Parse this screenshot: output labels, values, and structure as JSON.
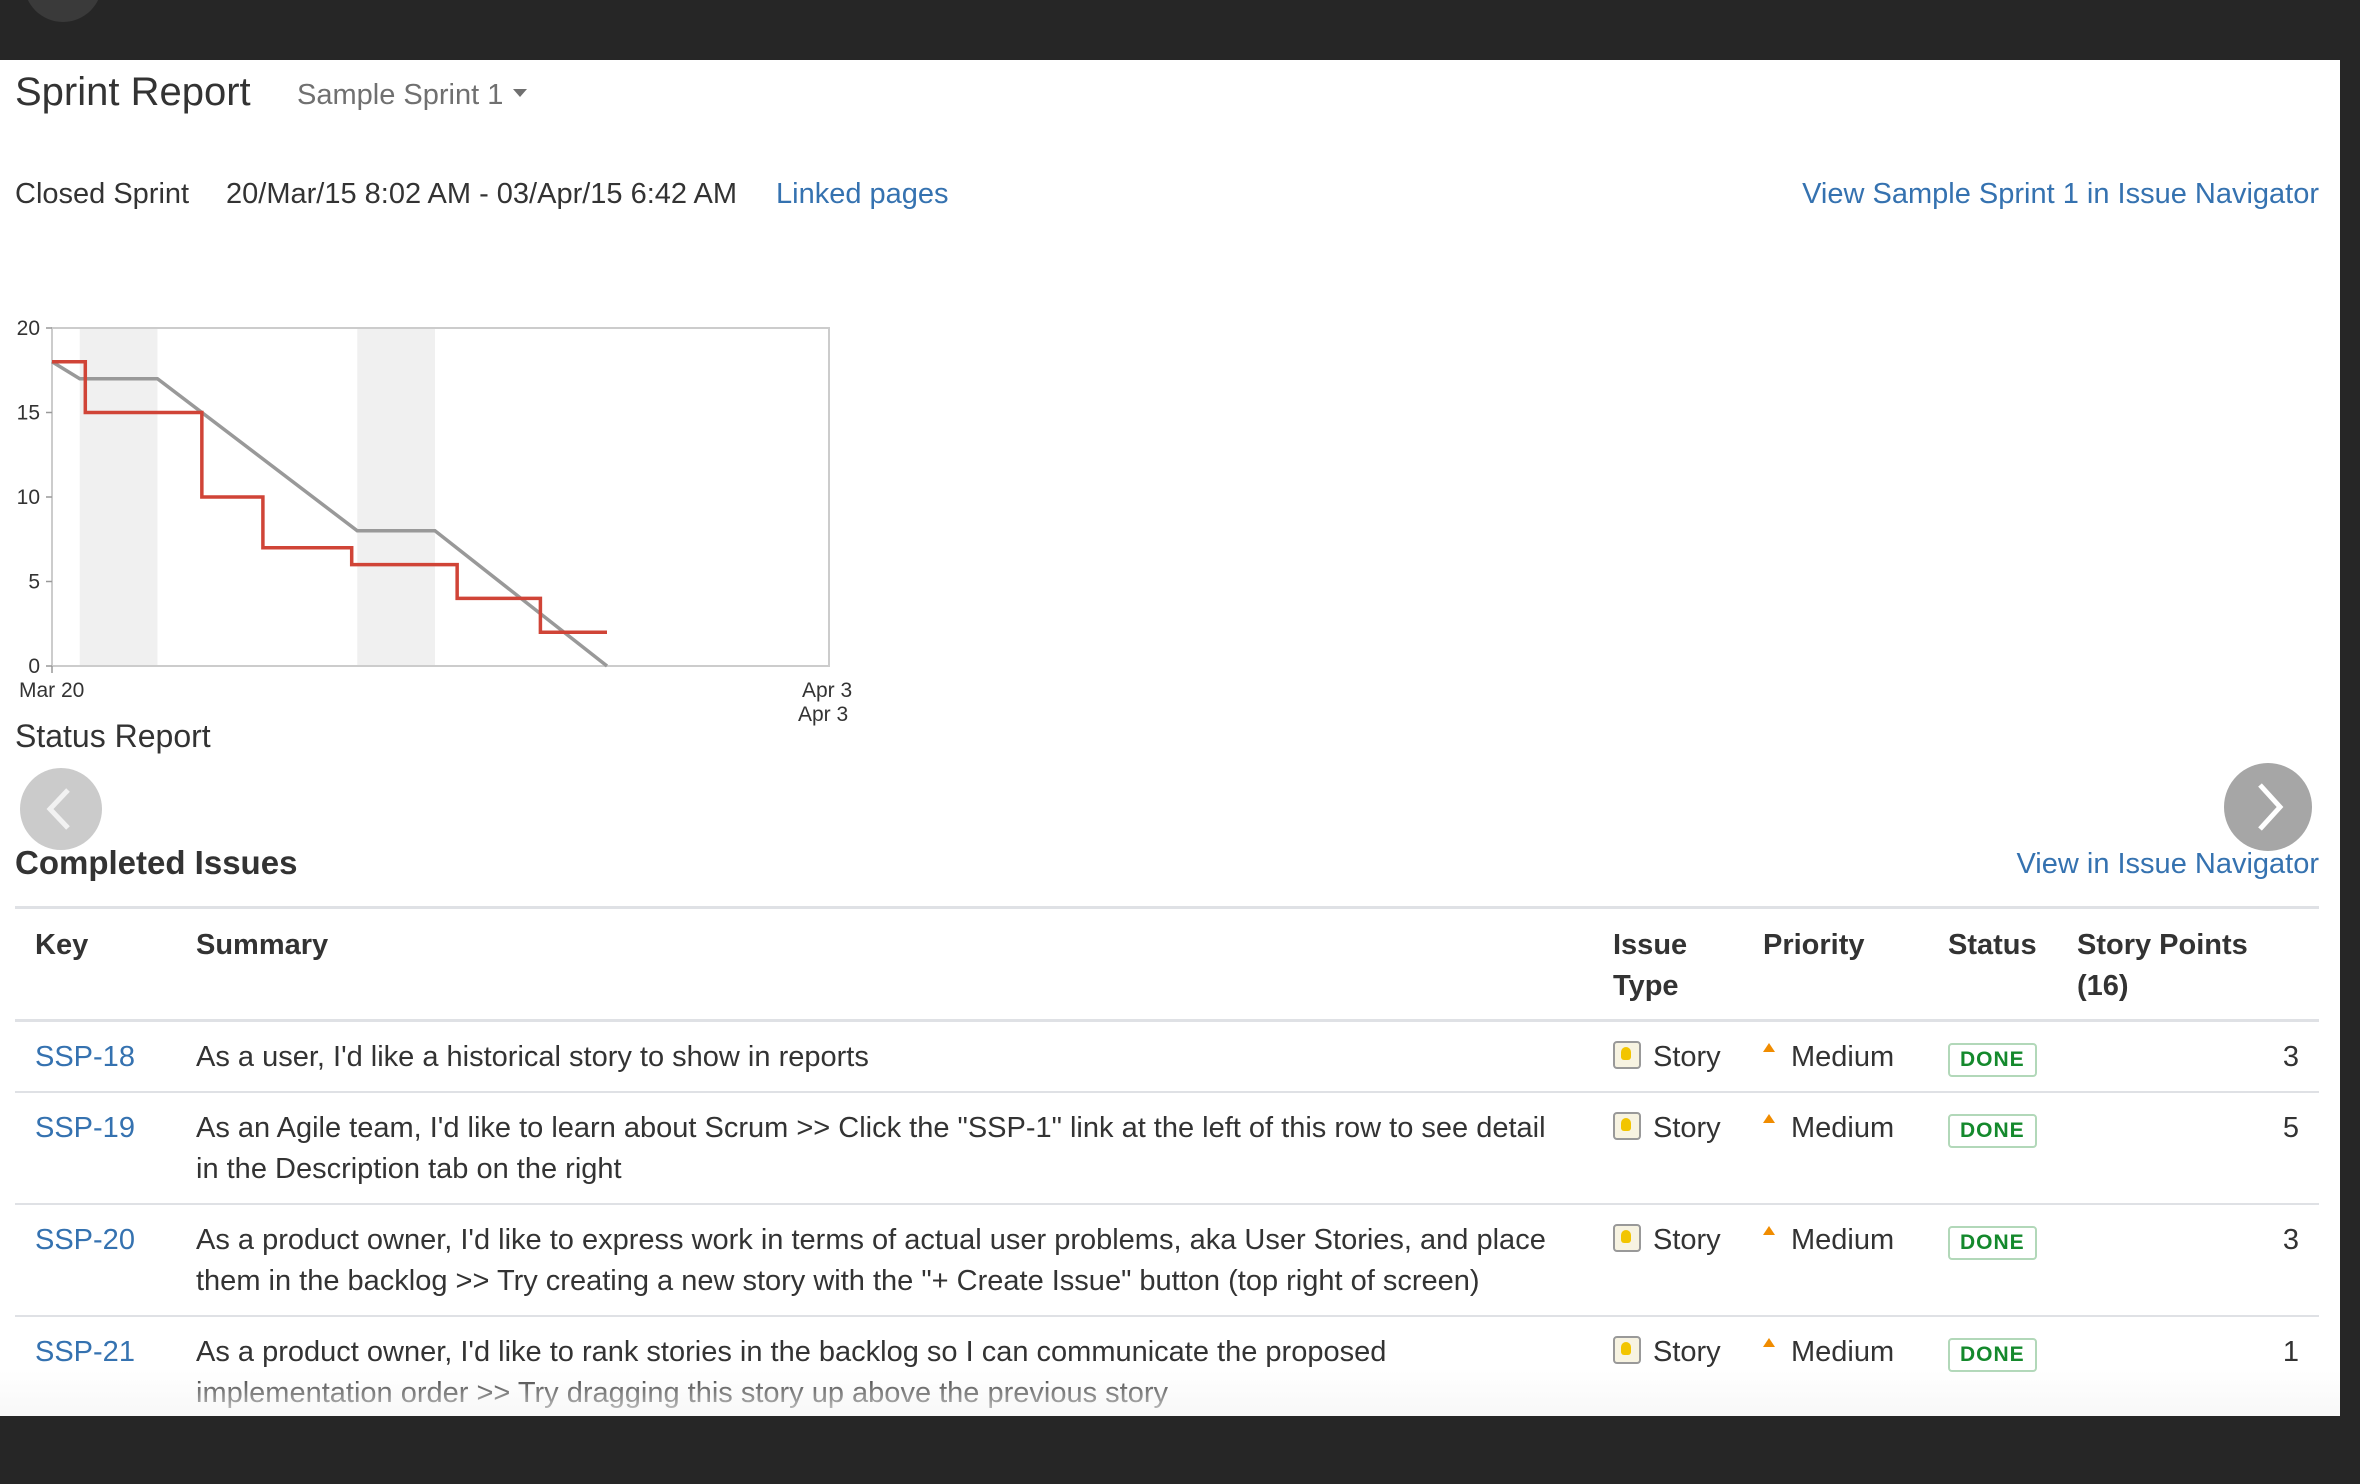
{
  "header": {
    "title": "Sprint Report",
    "sprint_selector": "Sample Sprint 1"
  },
  "sprint_meta": {
    "state": "Closed Sprint",
    "date_range": "20/Mar/15 8:02 AM - 03/Apr/15 6:42 AM",
    "linked_pages_label": "Linked pages",
    "view_in_navigator_label": "View Sample Sprint 1 in Issue Navigator"
  },
  "chart_data": {
    "type": "line",
    "x_labels": {
      "start": "Mar 20",
      "end": "Apr 3",
      "end_second": "Apr 3"
    },
    "ylim": [
      0,
      20
    ],
    "yticks": [
      0,
      5,
      10,
      15,
      20
    ],
    "xlim": [
      0,
      14
    ],
    "non_working_bands": [
      [
        0.5,
        1.9
      ],
      [
        5.5,
        6.9
      ]
    ],
    "series": [
      {
        "color": "#d04437",
        "step": true,
        "points": [
          [
            0,
            18
          ],
          [
            0.6,
            18
          ],
          [
            0.6,
            15
          ],
          [
            2.7,
            15
          ],
          [
            2.7,
            10
          ],
          [
            3.8,
            10
          ],
          [
            3.8,
            7
          ],
          [
            5.4,
            7
          ],
          [
            5.4,
            6
          ],
          [
            7.3,
            6
          ],
          [
            7.3,
            4
          ],
          [
            8.8,
            4
          ],
          [
            8.8,
            2
          ],
          [
            10,
            2
          ]
        ]
      },
      {
        "color": "#999999",
        "step": false,
        "points": [
          [
            0,
            18
          ],
          [
            0.5,
            17
          ],
          [
            1.9,
            17
          ],
          [
            5.5,
            8
          ],
          [
            6.9,
            8
          ],
          [
            10,
            0
          ]
        ]
      }
    ]
  },
  "status_report": {
    "title": "Status Report"
  },
  "completed": {
    "title": "Completed Issues",
    "view_link": "View in Issue Navigator",
    "columns": {
      "key": "Key",
      "summary": "Summary",
      "issue_type": "Issue Type",
      "priority": "Priority",
      "status": "Status",
      "points": "Story Points (16)"
    },
    "rows": [
      {
        "key": "SSP-18",
        "summary": "As a user, I'd like a historical story to show in reports",
        "type": "Story",
        "type_icon": "story-icon",
        "priority": "Medium",
        "priority_icon": "priority-medium-icon",
        "status": "DONE",
        "points": "3"
      },
      {
        "key": "SSP-19",
        "summary": "As an Agile team, I'd like to learn about Scrum >> Click the \"SSP-1\" link at the left of this row to see detail in the Description tab on the right",
        "type": "Story",
        "type_icon": "story-icon",
        "priority": "Medium",
        "priority_icon": "priority-medium-icon",
        "status": "DONE",
        "points": "5"
      },
      {
        "key": "SSP-20",
        "summary": "As a product owner, I'd like to express work in terms of actual user problems, aka User Stories, and place them in the backlog >> Try creating a new story with the \"+ Create Issue\" button (top right of screen)",
        "type": "Story",
        "type_icon": "story-icon",
        "priority": "Medium",
        "priority_icon": "priority-medium-icon",
        "status": "DONE",
        "points": "3"
      },
      {
        "key": "SSP-21",
        "summary": "As a product owner, I'd like to rank stories in the backlog so I can communicate the proposed implementation order >> Try dragging this story up above the previous story",
        "type": "Story",
        "type_icon": "story-icon",
        "priority": "Medium",
        "priority_icon": "priority-medium-icon",
        "status": "DONE",
        "points": "1"
      }
    ]
  },
  "colors": {
    "link": "#3572b0",
    "done_green": "#14892c",
    "priority_orange": "#f08c00",
    "burndown_actual": "#d04437",
    "guideline": "#999999"
  }
}
